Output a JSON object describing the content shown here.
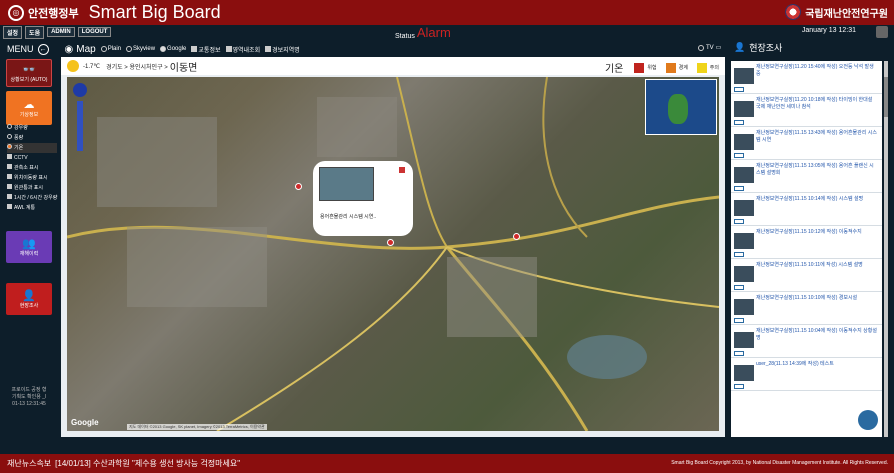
{
  "header": {
    "ministry": "안전행정부",
    "app_title": "Smart Big Board",
    "institute": "국립재난안전연구원",
    "buttons": [
      "설정",
      "도움",
      "ADMIN",
      "LOGOUT"
    ],
    "status_label": "Status",
    "alarm_label": "Alarm",
    "datetime": "January 13  12:31"
  },
  "menu": {
    "menu_label": "MENU",
    "map_label": "Map",
    "map_options": [
      "Plain",
      "Skyview",
      "Google"
    ],
    "map_selected": "Google",
    "layer_options": [
      "교통정보",
      "영역내조회",
      "경보지역명"
    ],
    "tv_label": "TV",
    "right_header": "현장조사"
  },
  "sidebar": {
    "btn_auto": "상황보기 (AUTO)",
    "btn_weather": "기상정보",
    "weather_options": [
      "강우량",
      "풍량",
      "기온"
    ],
    "extra_options": [
      "CCTV",
      "관측소 표시",
      "위치이동량 표시",
      "원관통과 표시",
      "1시간 / 6시간 강우량",
      "AWL 계통"
    ],
    "btn_disaster": "재해이력",
    "btn_field": "현장조사",
    "footer_lines": [
      "프로이드 공정 형",
      "기획도 확인용 _l",
      "01-13 12:31:45"
    ]
  },
  "mapinfo": {
    "temp": "-1.7℃",
    "region": "경기도 > 용인시처인구 >",
    "location": "이동면",
    "legend_title": "기온",
    "legend": [
      {
        "label": "위험",
        "color": "#c0241e"
      },
      {
        "label": "경계",
        "color": "#e07a1c"
      },
      {
        "label": "주의",
        "color": "#efd41a"
      }
    ]
  },
  "popup": {
    "caption": "용어흔물관리 시스템 시연.."
  },
  "map_footer": {
    "google": "Google",
    "copyright": "지도 데이터 ©2013 Google, SK planet, Imagery ©2013 TerraMetrics, 이용약관"
  },
  "feed": [
    {
      "text": "재난정보연구실장(11.20 15:40에 작성) 오전등 낙석 발생중"
    },
    {
      "text": "재난정보연구실장(11.20 10:18에 작성) 타이밍이 한대설 국제 재난안전 세미나 참석"
    },
    {
      "text": "재난정보연구실장(11.15 13:43에 작성) 용어흔물관리 시스템 시연"
    },
    {
      "text": "재난정보연구실장(11.15 13:05에 작성) 용어흔 플랜신 시스템 설명회"
    },
    {
      "text": "재난정보연구실장(11.15 10:14에 작성) 시스템 설명"
    },
    {
      "text": "재난정보연구실장(11.15 10:12에 작성) 이동적수지"
    },
    {
      "text": "재난정보연구실장(11.15 10:11에 작성) 시스템 설명"
    },
    {
      "text": "재난정보연구실장(11.15 10:10에 작성) 경보시설"
    },
    {
      "text": "재난정보연구실장(11.15 10:04에 작성) 이동적수지 상황설명"
    },
    {
      "text": "user_28(11.13 14:39에 작성) 테스트"
    }
  ],
  "bottom": {
    "ticker_label": "재난뉴스속보",
    "ticker_text": "[14/01/13] 수산과학원 \"제수용 생선 방사능 걱정마세요\"",
    "copyright": "Smart Big Board Copyright 2013, by National Disaster Management Institute. All Rights Reserved."
  },
  "colors": {
    "header_red": "#8a0e0e",
    "weather_orange": "#f07322",
    "disaster_purple": "#6a3bb5",
    "field_red": "#c01e1e"
  }
}
